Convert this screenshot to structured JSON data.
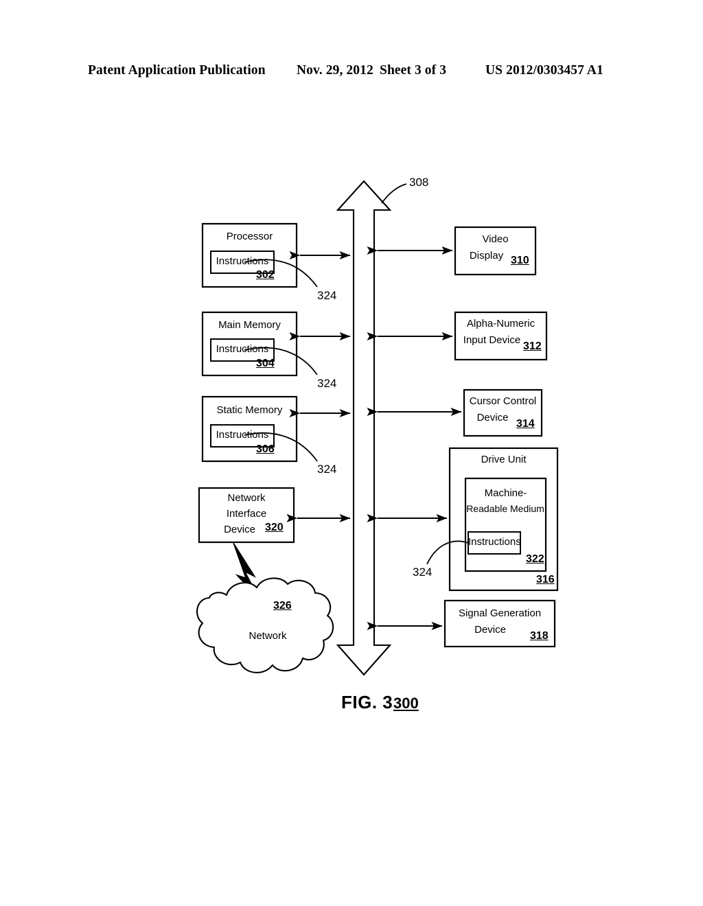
{
  "header": {
    "publication": "Patent Application Publication",
    "date": "Nov. 29, 2012",
    "sheet": "Sheet 3 of 3",
    "patent_number": "US 2012/0303457 A1"
  },
  "figure": {
    "caption": "FIG. 3",
    "caption_ref": "300",
    "bus": {
      "ref": "308"
    },
    "blocks": [
      {
        "title": "Processor",
        "ref": "302",
        "inner_label": "Instructions",
        "leader": "324"
      },
      {
        "title": "Main Memory",
        "ref": "304",
        "inner_label": "Instructions",
        "leader": "324"
      },
      {
        "title": "Static Memory",
        "ref": "306",
        "inner_label": "Instructions",
        "leader": "324"
      },
      {
        "title_line1": "Network",
        "title_line2": "Interface",
        "title_line3": "Device",
        "ref": "320"
      },
      {
        "title_line1": "Video",
        "title_line2": "Display",
        "ref": "310"
      },
      {
        "title_line1": "Alpha-Numeric",
        "title_line2": "Input Device",
        "ref": "312"
      },
      {
        "title_line1": "Cursor Control",
        "title_line2": "Device",
        "ref": "314"
      },
      {
        "title": "Drive Unit",
        "ref": "316",
        "medium_line1": "Machine-",
        "medium_line2": "Readable Medium",
        "medium_ref": "322",
        "inner_label": "Instructions",
        "leader": "324"
      },
      {
        "title_line1": "Signal Generation",
        "title_line2": "Device",
        "ref": "318"
      }
    ],
    "cloud": {
      "label": "Network",
      "ref": "326"
    }
  },
  "colors": {
    "ink": "#000000",
    "paper": "#ffffff"
  }
}
